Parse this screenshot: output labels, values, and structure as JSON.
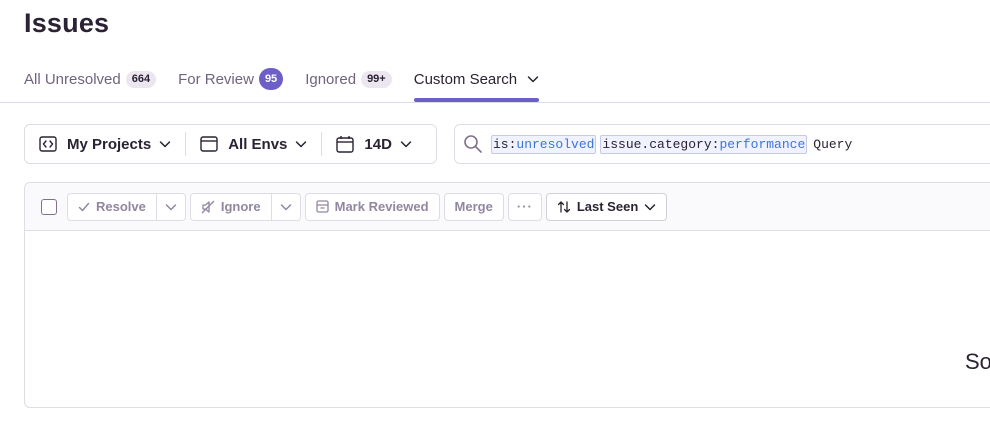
{
  "page": {
    "title": "Issues"
  },
  "tabs": [
    {
      "label": "All Unresolved",
      "badge": "664"
    },
    {
      "label": "For Review",
      "badge": "95"
    },
    {
      "label": "Ignored",
      "badge": "99+"
    },
    {
      "label": "Custom Search"
    }
  ],
  "filters": {
    "projects": "My Projects",
    "envs": "All Envs",
    "date": "14D"
  },
  "search": {
    "tokens": [
      {
        "key": "is:",
        "value": "unresolved"
      },
      {
        "key": "issue.category:",
        "value": "performance"
      }
    ],
    "query_text": "Query"
  },
  "actions": {
    "resolve": "Resolve",
    "ignore": "Ignore",
    "mark_reviewed": "Mark Reviewed",
    "merge": "Merge",
    "more": "···",
    "sort": "Last Seen"
  },
  "empty": {
    "text": "So"
  },
  "colors": {
    "accent": "#6c5fc7",
    "token_value": "#3c74dd"
  }
}
